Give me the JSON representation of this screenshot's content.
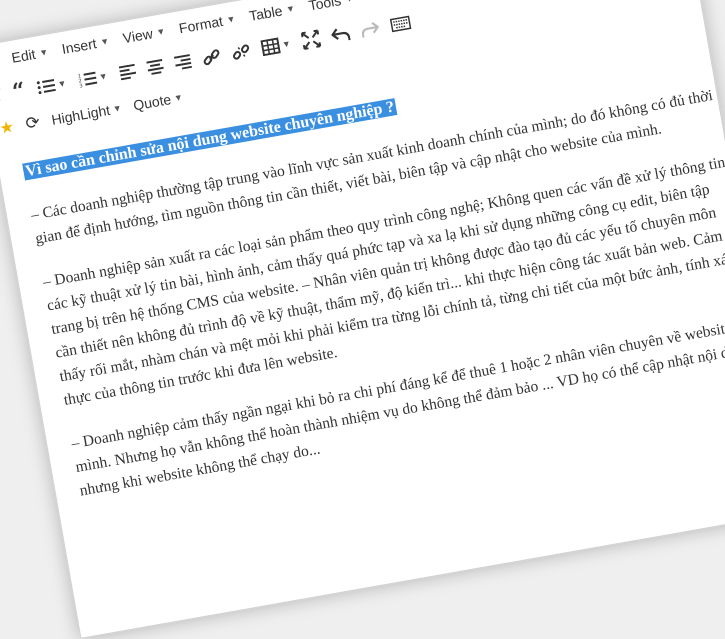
{
  "menu": [
    {
      "id": "edit",
      "label": "Edit"
    },
    {
      "id": "insert",
      "label": "Insert"
    },
    {
      "id": "view",
      "label": "View"
    },
    {
      "id": "format",
      "label": "Format"
    },
    {
      "id": "table",
      "label": "Table"
    },
    {
      "id": "tools",
      "label": "Tools"
    }
  ],
  "toolbar": {
    "highlight_label": "HighLight",
    "quote_label": "Quote"
  },
  "content": {
    "heading": "Vì sao cần chỉnh sửa nội dung website chuyên nghiệp ?",
    "tail_before": "Các doanh nghiệp thường tập trung vào lĩnh vực sản xuất kinh doanh chính của mình; do đó không có đủ thời gian để định hướng, tìm nguồn thông tin cần thiết, viết bài, biên tập ",
    "tail_spell": "và",
    "tail_after": " cập nhật",
    "para1": "– Các doanh nghiệp thường tập trung vào lĩnh vực sản xuất kinh doanh chính của mình; do đó không có đủ thời gian để định hướng, tìm nguồn thông tin cần thiết, viết bài, biên tập và cập nhật cho website của mình.",
    "para2": "– Doanh nghiệp sản xuất ra các loại sản phẩm theo quy trình công nghệ; Không quen các vấn đề xử lý thông tin, các kỹ thuật xử lý tin bài, hình ảnh, cảm thấy quá phức tạp và xa lạ khi sử dụng những công cụ edit, biên tập trang bị trên hệ thống CMS của website. – Nhân viên quản trị không được đào tạo đủ các yếu tố chuyên môn cần thiết nên không đủ trình độ về kỹ thuật, thẩm mỹ, độ kiến trì... khi thực hiện công tác xuất bản web. Cảm thấy rối mắt, nhàm chán và mệt mỏi khi phải kiểm tra từng lỗi chính tả, từng chi tiết của một bức ảnh, tính xác thực của thông tin trước khi đưa lên website.",
    "para3": "– Doanh nghiệp cảm thấy ngần ngại khi bỏ ra chi phí đáng kể để thuê 1 hoặc 2 nhân viên chuyên về website cho mình. Nhưng họ vẫn không thể hoàn thành nhiệm vụ do không thể đảm bảo ... VD họ có thể cập nhật nội dung nhưng khi website không thể chạy do..."
  }
}
